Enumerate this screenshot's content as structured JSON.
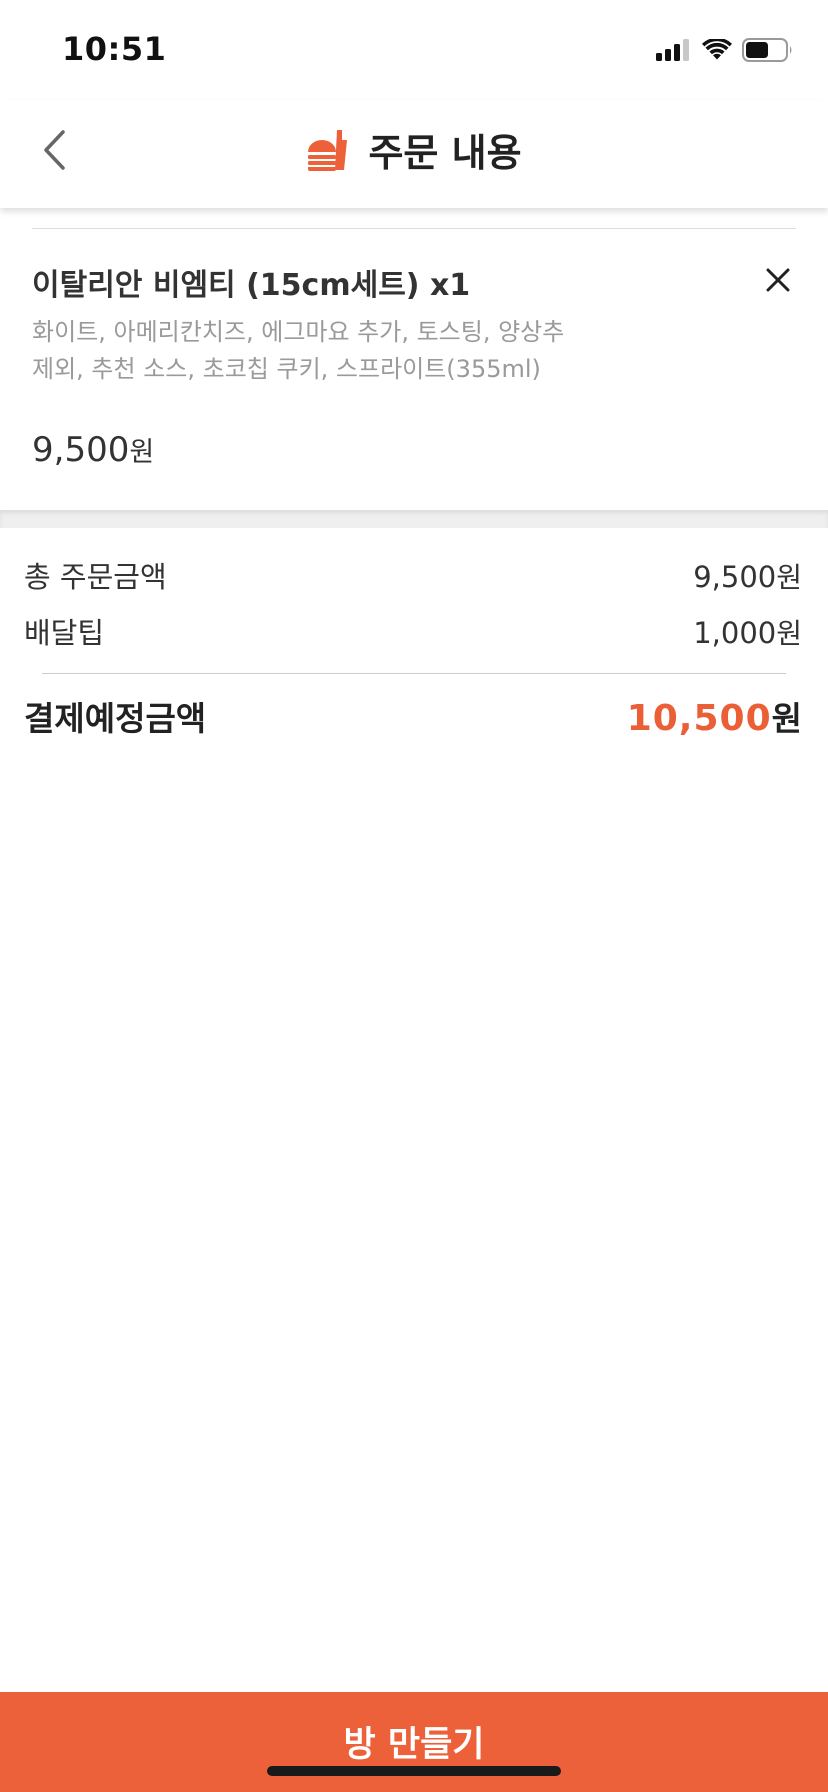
{
  "status_bar": {
    "time": "10:51"
  },
  "header": {
    "title": "주문 내용",
    "back_icon": "chevron-left-icon",
    "logo_icon": "burger-drink-icon"
  },
  "order_item": {
    "name": "이탈리안 비엠티 (15cm세트) x1",
    "options": "화이트, 아메리칸치즈, 에그마요 추가, 토스팅, 양상추 제외, 추천 소스, 초코칩 쿠키, 스프라이트(355ml)",
    "price": "9,500",
    "price_unit": "원"
  },
  "summary": {
    "order_total_label": "총 주문금액",
    "order_total_value": "9,500",
    "delivery_tip_label": "배달팁",
    "delivery_tip_value": "1,000",
    "unit": "원",
    "payment_label": "결제예정금액",
    "payment_value": "10,500",
    "payment_unit": "원"
  },
  "cta": {
    "label": "방 만들기"
  },
  "colors": {
    "accent": "#ec6139",
    "total_text": "#ea5f36"
  }
}
